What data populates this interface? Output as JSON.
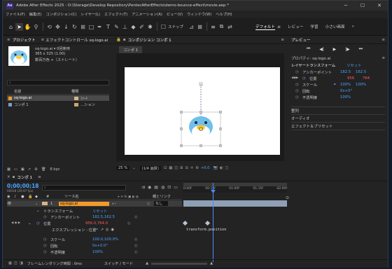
{
  "titlebar": {
    "app_icon": "Ae",
    "title": "Adobe After Effects 2025 - D:\\Storage\\Develop Repository\\PentecAfterEffects\\demo-bounce-effect\\movie.aep *",
    "minimize": "─",
    "maximize": "☐",
    "close": "✕"
  },
  "menu": [
    "ファイル(F)",
    "編集(E)",
    "コンポジション(C)",
    "レイヤー(L)",
    "エフェクト(T)",
    "アニメーション(A)",
    "ビュー(V)",
    "ウィンドウ(W)",
    "ヘルプ(H)"
  ],
  "toolbar": {
    "snap_label": "スナップ",
    "workspaces": [
      "デフォルト",
      "レビュー",
      "学習",
      "小さい画面"
    ],
    "more": "»"
  },
  "project": {
    "tab": "プロジェクト",
    "effects_tab": "エフェクトコントロール sq-logo.ai",
    "item_name": "sq-logo.ai ▾ 0回使用",
    "item_size": "365 x 325 (1.00)",
    "item_color": "数百万色 +（ストレート）",
    "search_placeholder": "⌕",
    "col_name": "名前",
    "col_type": "種類",
    "items": [
      {
        "name": "sq-logo.ai",
        "type": "ﾌｧｰﾄ",
        "color": "#d5b68a"
      },
      {
        "name": "コンポ 1",
        "type": "…ション",
        "color": "#c8a86a"
      }
    ],
    "bpc": "8 bpc"
  },
  "comp": {
    "tab": "コンポジション コンポ 1",
    "sub_tab": "コンポ 1",
    "zoom": "25 %",
    "resolution": "(1/4 画質)",
    "exposure": "+0.0"
  },
  "preview": {
    "tab": "プレビュー"
  },
  "properties": {
    "tab": "プロパティ: sq-logo.ai",
    "layer_transform": "レイヤートランスフォーム",
    "reset": "リセット",
    "anchor_label": "アンカーポイント",
    "anchor_x": "182.5",
    "anchor_y": "162.5",
    "position_label": "位置",
    "position_x": "956",
    "position_y": "764",
    "scale_label": "スケール",
    "scale_x": "100%",
    "scale_y": "100%",
    "rotation_label": "回転",
    "rotation_value": "0x+0°",
    "opacity_label": "不透明度",
    "opacity_value": "100%",
    "sections": [
      "整列",
      "オーディオ",
      "エフェクト＆プリセット"
    ]
  },
  "timeline": {
    "tab": "コンポ 1",
    "timecode": "0;00;00;18",
    "timecode_sub": "00018 (29.97 fps)",
    "search_placeholder": "⌕",
    "col_source": "ソース名",
    "col_parent": "親とリンク",
    "layer_num": "1",
    "layer_name": "sq-logo.ai",
    "parent_value": "なし",
    "transform": "トランスフォーム",
    "reset": "リセット",
    "anchor_label": "アンカーポイント",
    "anchor_value": "182.5,162.5",
    "position_label": "位置",
    "position_value": "956.0,764.0",
    "expression_label": "エクスプレッション : 位置",
    "expression_text": "transform.position",
    "scale_label": "スケール",
    "scale_value": "100.0,100.0%",
    "rotation_label": "回転",
    "rotation_value": "0x+0.0°",
    "opacity_label": "不透明度",
    "opacity_value": "100%",
    "ruler": [
      "0:00f",
      "00:15f",
      "01:00f",
      "01:15f",
      "02:00f"
    ],
    "footer_render": "フレームレンダリング時間 : 0ms",
    "footer_switch": "スイッチ / モード"
  }
}
